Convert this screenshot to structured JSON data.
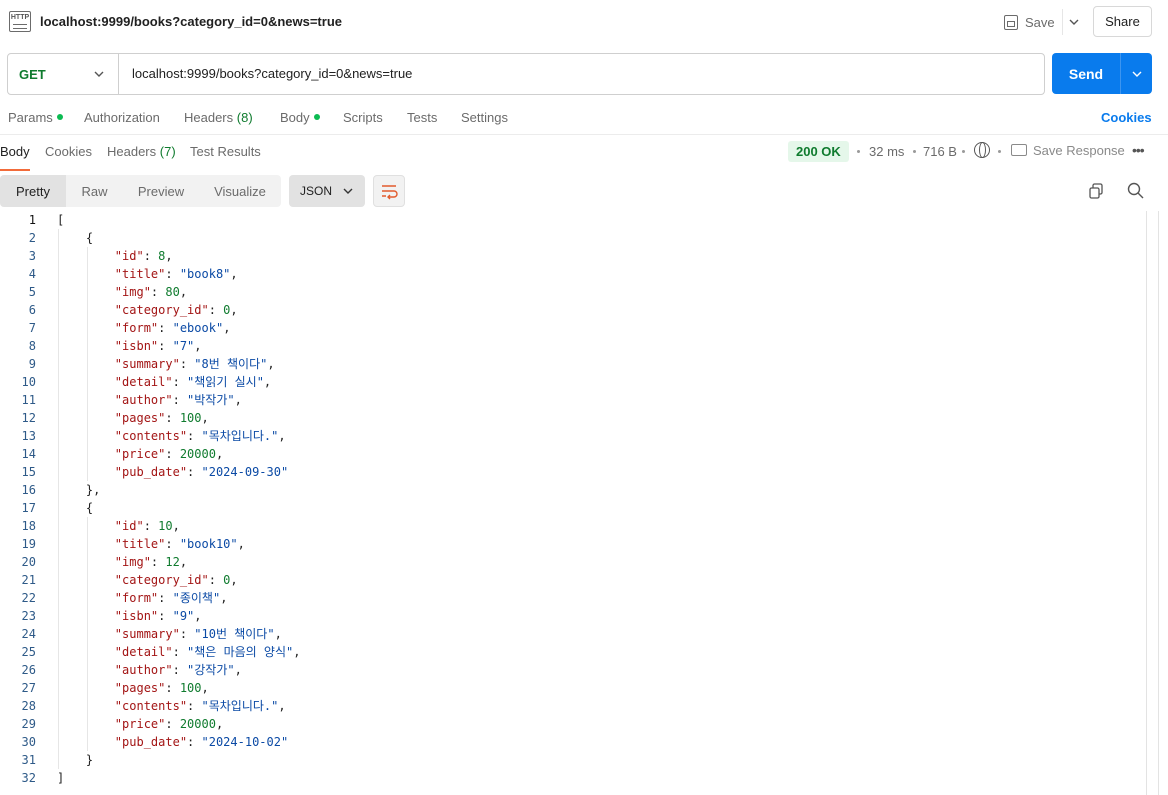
{
  "tab": {
    "title": "localhost:9999/books?category_id=0&news=true",
    "icon": "http-request-icon"
  },
  "header": {
    "save_label": "Save",
    "share_label": "Share"
  },
  "request": {
    "method": "GET",
    "url": "localhost:9999/books?category_id=0&news=true",
    "send_label": "Send"
  },
  "request_tabs": {
    "params": "Params",
    "authorization": "Authorization",
    "headers": "Headers",
    "headers_count": "(8)",
    "body": "Body",
    "scripts": "Scripts",
    "tests": "Tests",
    "settings": "Settings",
    "cookies": "Cookies"
  },
  "response_tabs": {
    "body": "Body",
    "cookies": "Cookies",
    "headers": "Headers",
    "headers_count": "(7)",
    "test_results": "Test Results"
  },
  "response_meta": {
    "status": "200 OK",
    "time": "32 ms",
    "size": "716 B",
    "save_response": "Save Response"
  },
  "view_modes": [
    "Pretty",
    "Raw",
    "Preview",
    "Visualize"
  ],
  "format": "JSON",
  "colors": {
    "accent": "#097bed",
    "status_bg": "#e5f7ea",
    "status_fg": "#0f7b2e",
    "active_tab": "#f26b3a"
  },
  "response_body": [
    {
      "id": 8,
      "title": "book8",
      "img": 80,
      "category_id": 0,
      "form": "ebook",
      "isbn": "7",
      "summary": "8번 책이다",
      "detail": "책읽기 실시",
      "author": "박작가",
      "pages": 100,
      "contents": "목차입니다.",
      "price": 20000,
      "pub_date": "2024-09-30"
    },
    {
      "id": 10,
      "title": "book10",
      "img": 12,
      "category_id": 0,
      "form": "종이책",
      "isbn": "9",
      "summary": "10번 책이다",
      "detail": "책은 마음의 양식",
      "author": "강작가",
      "pages": 100,
      "contents": "목차입니다.",
      "price": 20000,
      "pub_date": "2024-10-02"
    }
  ]
}
